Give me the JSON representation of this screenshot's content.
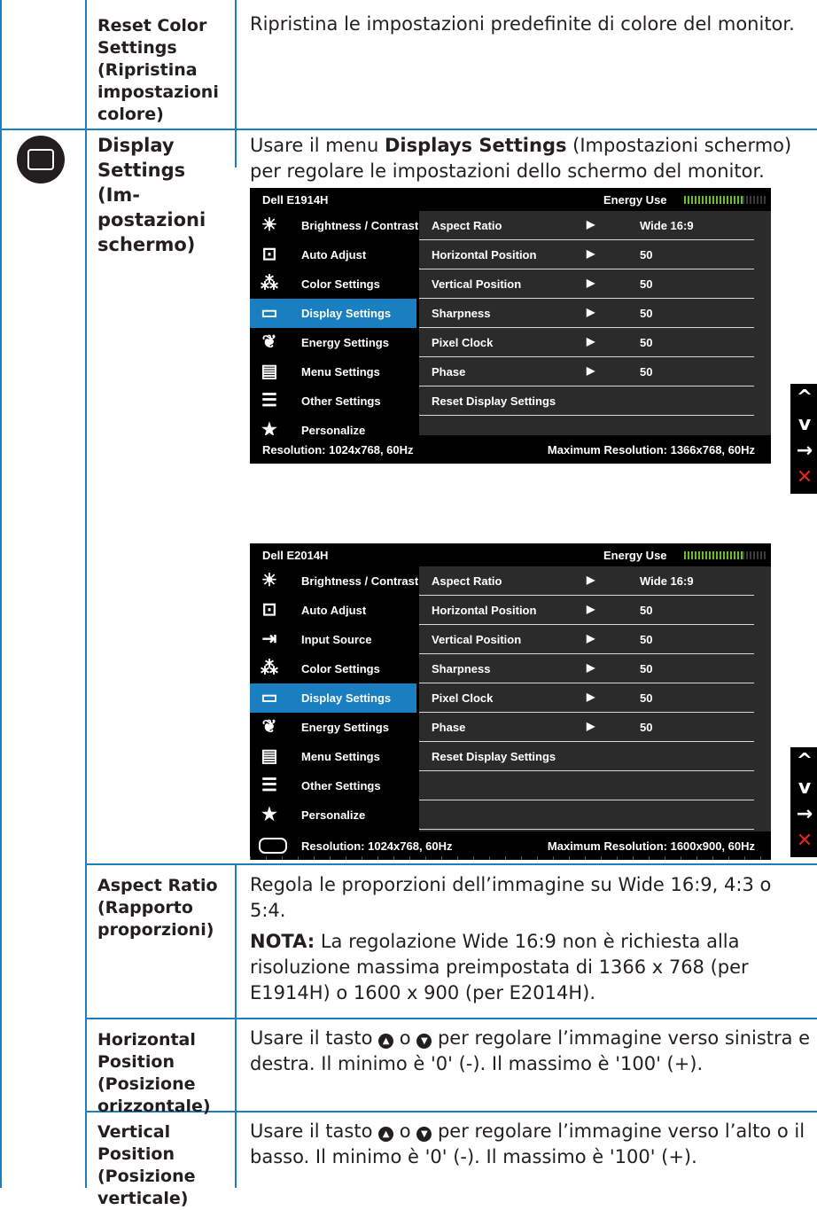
{
  "rows": {
    "reset_color": {
      "label": "Reset Color Settings (Ripristina impostazioni colore)",
      "description": "Ripristina le impostazioni predefinite di colore del monitor."
    },
    "display_settings": {
      "label": "Display Settings (Im-postazioni schermo)",
      "desc_pre": "Usare il menu ",
      "desc_bold": "Displays Settings",
      "desc_post": " (Impostazioni schermo) per regolare le impostazioni dello schermo del monitor."
    },
    "aspect_ratio": {
      "label": "Aspect Ratio (Rapporto proporzioni)",
      "description": "Regola le proporzioni dell’immagine su Wide 16:9, 4:3 o 5:4.",
      "note_label": "NOTA:",
      "note_text": " La regolazione Wide 16:9 non è richiesta alla risoluzione massima preimpostata di 1366 x 768 (per E1914H) o 1600 x 900 (per E2014H)."
    },
    "horizontal": {
      "label": "Horizontal Position (Posizione orizzontale)",
      "desc_pre": "Usare il tasto ",
      "desc_mid": " o ",
      "desc_post": " per regolare l’immagine verso sinistra e destra. Il minimo è '0' (-). Il massimo è '100' (+)."
    },
    "vertical": {
      "label": "Vertical Position (Posizione verticale)",
      "desc_pre": " Usare il tasto ",
      "desc_mid": " o ",
      "desc_post": " per regolare l’immagine verso l’alto o il basso. Il minimo è '0' (-). Il massimo è '100' (+)."
    }
  },
  "osd1": {
    "model": "Dell E1914H",
    "energy_label": "Energy Use",
    "menu": [
      {
        "icon": "brightness-icon",
        "glyph": "☀",
        "label": "Brightness / Contrast"
      },
      {
        "icon": "auto-adjust-icon",
        "glyph": "⊡",
        "label": "Auto Adjust"
      },
      {
        "icon": "color-settings-icon",
        "glyph": "⁂",
        "label": "Color Settings"
      },
      {
        "icon": "display-settings-icon",
        "glyph": "▭",
        "label": "Display Settings",
        "selected": true
      },
      {
        "icon": "energy-settings-icon",
        "glyph": "❦",
        "label": "Energy Settings"
      },
      {
        "icon": "menu-settings-icon",
        "glyph": "▤",
        "label": "Menu Settings"
      },
      {
        "icon": "other-settings-icon",
        "glyph": "☰",
        "label": "Other Settings"
      },
      {
        "icon": "personalize-icon",
        "glyph": "★",
        "label": "Personalize"
      }
    ],
    "options": [
      {
        "name": "Aspect Ratio",
        "arrow": "▶",
        "value": "Wide 16:9"
      },
      {
        "name": "Horizontal Position",
        "arrow": "▶",
        "value": "50"
      },
      {
        "name": "Vertical Position",
        "arrow": "▶",
        "value": "50"
      },
      {
        "name": "Sharpness",
        "arrow": "▶",
        "value": "50"
      },
      {
        "name": "Pixel Clock",
        "arrow": "▶",
        "value": "50"
      },
      {
        "name": "Phase",
        "arrow": "▶",
        "value": "50"
      },
      {
        "name": "Reset Display Settings",
        "arrow": "",
        "value": ""
      }
    ],
    "resolution": "Resolution: 1024x768, 60Hz",
    "max_resolution": "Maximum Resolution: 1366x768, 60Hz"
  },
  "osd2": {
    "model": "Dell E2014H",
    "energy_label": "Energy Use",
    "menu": [
      {
        "icon": "brightness-icon",
        "glyph": "☀",
        "label": "Brightness / Contrast"
      },
      {
        "icon": "auto-adjust-icon",
        "glyph": "⊡",
        "label": "Auto Adjust"
      },
      {
        "icon": "input-source-icon",
        "glyph": "⇥",
        "label": "Input Source"
      },
      {
        "icon": "color-settings-icon",
        "glyph": "⁂",
        "label": "Color Settings"
      },
      {
        "icon": "display-settings-icon",
        "glyph": "▭",
        "label": "Display Settings",
        "selected": true
      },
      {
        "icon": "energy-settings-icon",
        "glyph": "❦",
        "label": "Energy Settings"
      },
      {
        "icon": "menu-settings-icon",
        "glyph": "▤",
        "label": "Menu Settings"
      },
      {
        "icon": "other-settings-icon",
        "glyph": "☰",
        "label": "Other Settings"
      },
      {
        "icon": "personalize-icon",
        "glyph": "★",
        "label": "Personalize"
      }
    ],
    "options": [
      {
        "name": "Aspect Ratio",
        "arrow": "▶",
        "value": "Wide 16:9"
      },
      {
        "name": "Horizontal Position",
        "arrow": "▶",
        "value": "50"
      },
      {
        "name": "Vertical Position",
        "arrow": "▶",
        "value": "50"
      },
      {
        "name": "Sharpness",
        "arrow": "▶",
        "value": "50"
      },
      {
        "name": "Pixel Clock",
        "arrow": "▶",
        "value": "50"
      },
      {
        "name": "Phase",
        "arrow": "▶",
        "value": "50"
      },
      {
        "name": "Reset Display Settings",
        "arrow": "",
        "value": ""
      }
    ],
    "resolution": "Resolution: 1024x768, 60Hz",
    "max_resolution": "Maximum Resolution: 1600x900, 60Hz"
  },
  "side_buttons": {
    "up": "^",
    "down": "v",
    "enter": "→",
    "exit": "✕"
  },
  "colors": {
    "table_border": "#1a7fc1",
    "selection": "#1a7fc1",
    "energy_bar": "#6bbf2a",
    "exit": "#e1261c"
  }
}
